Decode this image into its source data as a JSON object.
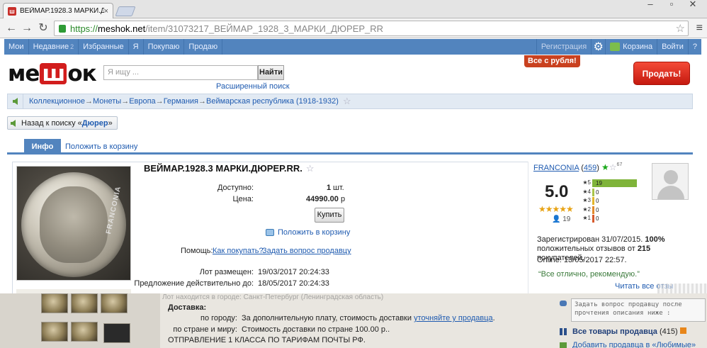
{
  "browser": {
    "tab_title": "ВЕЙМАР.1928.3 МАРКИ.ДЮ",
    "tab_close": "×",
    "url_scheme": "https://",
    "url_host": "meshok.net",
    "url_path": "/item/31073217_ВЕЙМАР_1928_3_МАРКИ_ДЮРЕР_RR"
  },
  "nav": {
    "items": [
      {
        "label": "Мои"
      },
      {
        "label": "Недавние",
        "count": "2"
      },
      {
        "label": "Избранные"
      },
      {
        "label": "Я"
      },
      {
        "label": "Покупаю"
      },
      {
        "label": "Продаю"
      }
    ],
    "register": "Регистрация",
    "cart": "Корзина",
    "login": "Войти",
    "help": "?"
  },
  "header": {
    "logo_pre": "ме",
    "logo_mid": "ш",
    "logo_post": "ок",
    "search_placeholder": "Я ищу ...",
    "search_button": "Найти",
    "advanced_search": "Расширенный поиск",
    "promo": "Все с рубля!",
    "sell_button": "Продать!"
  },
  "breadcrumbs": [
    "Коллекционное",
    "Монеты",
    "Европа",
    "Германия",
    "Веймарская республика (1918-1932)"
  ],
  "breadcrumb_sep": "→",
  "back_to_search": {
    "prefix": "Назад к поиску «",
    "query": "Дюрер",
    "suffix": "»"
  },
  "tabs": {
    "info": "Инфо",
    "add_to_cart": "Положить в корзину"
  },
  "lot": {
    "title": "ВЕЙМАР.1928.3 МАРКИ.ДЮРЕР.RR.",
    "available_label": "Доступно:",
    "available_value": "1",
    "available_unit": "шт.",
    "price_label": "Цена:",
    "price_value": "44990.00",
    "price_unit": "р",
    "buy_button": "Купить",
    "add_to_cart": "Положить в корзину",
    "help_label": "Помощь:",
    "help_how_to_buy": "Как покупать?",
    "help_ask_seller": "Задать вопрос продавцу",
    "placed_label": "Лот размещен:",
    "placed_value": "19/03/2017 20:24:33",
    "valid_label": "Предложение действительно до:",
    "valid_value": "18/05/2017 20:24:33",
    "watermark": "FRANCONIA"
  },
  "seller": {
    "name": "FRANCONIA",
    "count": "459",
    "sup": "67",
    "score": "5.0",
    "reviews": "19",
    "rating_bars": [
      {
        "star": "5",
        "count": "19",
        "fraction": 1.0
      },
      {
        "star": "4",
        "count": "0",
        "fraction": 0
      },
      {
        "star": "3",
        "count": "0",
        "fraction": 0
      },
      {
        "star": "2",
        "count": "0",
        "fraction": 0
      },
      {
        "star": "1",
        "count": "0",
        "fraction": 0
      }
    ],
    "registered_prefix": "Зарегистрирован 31/07/2015.",
    "positive_pct": "100%",
    "positive_text": "положительных отзывов от",
    "buyers_count": "215",
    "buyers_word": "покупателей.",
    "online": "Online: 13/05/2017 22:57.",
    "quote": "“Все отлично, рекомендую.”",
    "read_all": "Читать все отзы"
  },
  "lower": {
    "ghost": "Лот находится в городе: Санкт-Петербург (Ленинградская область)",
    "delivery_title": "Доставка:",
    "city_label": "по городу:",
    "city_text": "За дополнительную плату, стоимость доставки",
    "city_link": "уточняйте у продавца",
    "city_end": ".",
    "country_label": "по стране и миру:",
    "country_text": "Стоимость доставки по стране 100.00 р..",
    "shipping": "ОТПРАВЛЕНИЕ 1 КЛАССА ПО ТАРИФАМ ПОЧТЫ РФ.",
    "ask_box": "Задать вопрос продавцу после прочтения описания ниже :",
    "all_goods": "Все товары продавца",
    "all_goods_count": "(415)",
    "add_fav": "Добавить продавца в «Любимые»"
  },
  "colors": {
    "nav": "#5284be",
    "sell": "#d9261a",
    "link": "#1f5bb0",
    "promo": "#c9411f",
    "bar_fill": "#7fb43a"
  }
}
